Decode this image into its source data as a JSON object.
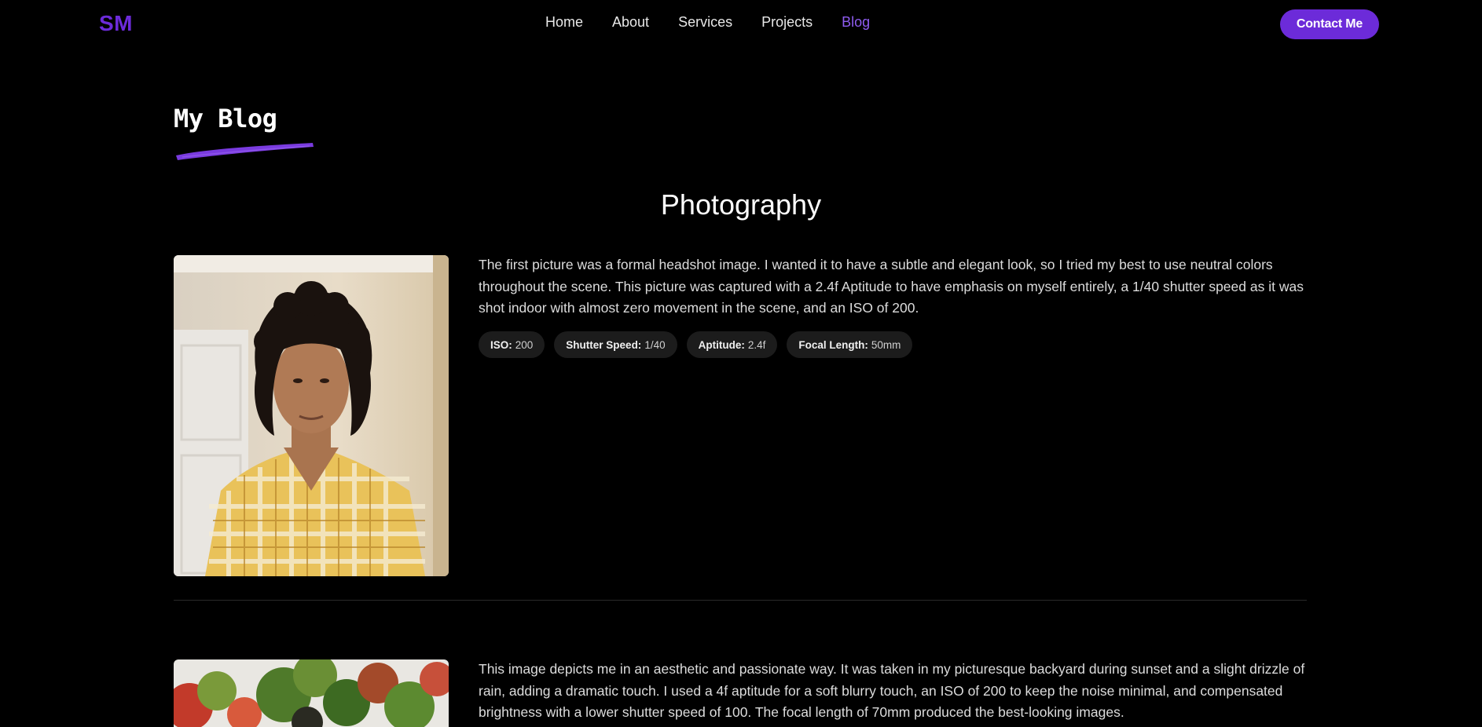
{
  "nav": {
    "logo": "SM",
    "links": [
      "Home",
      "About",
      "Services",
      "Projects",
      "Blog"
    ],
    "active": "Blog",
    "contact_label": "Contact Me"
  },
  "page": {
    "title": "My Blog",
    "section_title": "Photography"
  },
  "posts": [
    {
      "text": "The first picture was a formal headshot image. I wanted it to have a subtle and elegant look, so I tried my best to use neutral colors throughout the scene. This picture was captured with a 2.4f Aptitude to have emphasis on myself entirely, a 1/40 shutter speed as it was shot indoor with almost zero movement in the scene, and an ISO of 200.",
      "tags": [
        {
          "label": "ISO:",
          "value": "200"
        },
        {
          "label": "Shutter Speed:",
          "value": "1/40"
        },
        {
          "label": "Aptitude:",
          "value": "2.4f"
        },
        {
          "label": "Focal Length:",
          "value": "50mm"
        }
      ]
    },
    {
      "text": "This image depicts me in an aesthetic and passionate way. It was taken in my picturesque backyard during sunset and a slight drizzle of rain, adding a dramatic touch. I used a 4f aptitude for a soft blurry touch, an ISO of 200 to keep the noise minimal, and compensated brightness with a lower shutter speed of 100. The focal length of 70mm produced the best-looking images."
    }
  ],
  "colors": {
    "accent": "#6c2bd9",
    "active_link": "#8e5cf0",
    "background": "#000000",
    "tag_bg": "#1c1c1c"
  }
}
